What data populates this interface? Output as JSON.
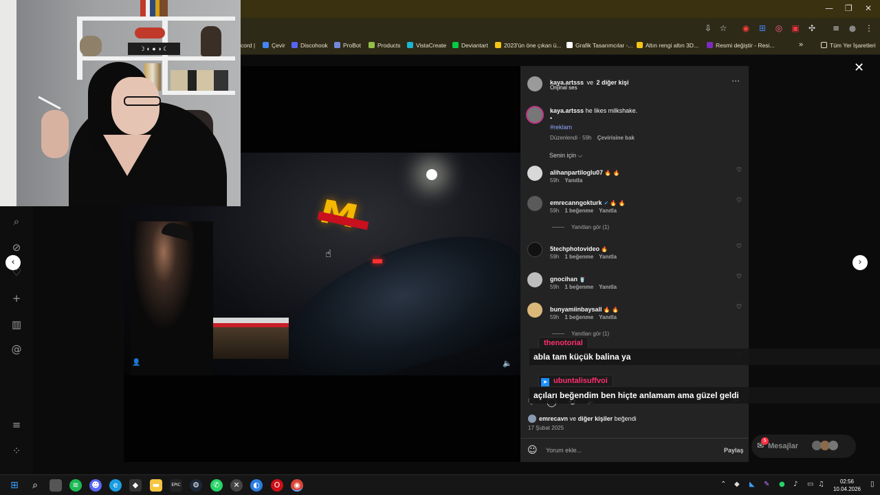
{
  "browser": {
    "bookmarks": [
      {
        "label": "cord |",
        "color": "#5865f2"
      },
      {
        "label": "Çevir",
        "color": "#4285f4"
      },
      {
        "label": "Discohook",
        "color": "#5865f2"
      },
      {
        "label": "ProBot",
        "color": "#7289da"
      },
      {
        "label": "Products",
        "color": "#95bf47"
      },
      {
        "label": "VistaCreate",
        "color": "#1bb6d2"
      },
      {
        "label": "Deviantart",
        "color": "#05cc47"
      },
      {
        "label": "2023'ün öne çıkan ü...",
        "color": "#f5c518"
      },
      {
        "label": "Grafik Tasarımcılar -...",
        "color": "#ffffff"
      },
      {
        "label": "Altın rengi altın 3D...",
        "color": "#f5c518"
      },
      {
        "label": "Resmi değiştir - Resi...",
        "color": "#7b2cbf"
      }
    ],
    "more_bookmarks": "»",
    "all_bookmarks": "Tüm Yer İşaretleri"
  },
  "post": {
    "header_user": "kaya.artsss",
    "header_connector": "ve",
    "header_others": "2 diğer kişi",
    "audio": "Orijinal ses",
    "more": "···",
    "caption_user": "kaya.artsss",
    "caption_text": "he likes milkshake.",
    "caption_dot": "•",
    "hashtag": "#reklam",
    "edited": "Düzenlendi · 59h",
    "translate": "Çevirisine bak",
    "sort": "Senin için ⌵",
    "likes_user": "emrecavn",
    "likes_connector": "ve",
    "likes_others": "diğer kişiler",
    "likes_suffix": "beğendi",
    "date": "17 Şubat 2025",
    "comment_placeholder": "Yorum ekle...",
    "share": "Paylaş"
  },
  "comments": [
    {
      "user": "alihanpartiloglu07",
      "emoji": "🔥 🔥",
      "time": "59h",
      "likes": "",
      "reply": "Yanıtla",
      "avatar": "#d8d8d8"
    },
    {
      "user": "emrecanngokturk",
      "emoji": "🔥 🔥",
      "verified": "✔",
      "time": "59h",
      "likes": "1 beğenme",
      "reply": "Yanıtla",
      "avatar": "#5a5a5a"
    },
    {
      "user": "5techphotovideo",
      "emoji": "🔥",
      "time": "59h",
      "likes": "1 beğenme",
      "reply": "Yanıtla",
      "avatar": "#111111"
    },
    {
      "user": "gnocihan",
      "emoji": "🥤",
      "time": "59h",
      "likes": "1 beğenme",
      "reply": "Yanıtla",
      "avatar": "#bdbdbd"
    },
    {
      "user": "bunyamiinbaysall",
      "emoji": "🔥 🔥",
      "time": "59h",
      "likes": "1 beğenme",
      "reply": "Yanıtla",
      "avatar": "#d9b87a"
    }
  ],
  "view_replies_1": "Yanıtları gör (1)",
  "view_replies_2": "Yanıtları gör (1)",
  "chat": [
    {
      "name": "thenotorial",
      "message": "abla tam küçük balina ya"
    },
    {
      "name": "ubuntalisuffvoi",
      "message": "açıları beğendim ben hiçte anlamam ama güzel geldi"
    }
  ],
  "messages_widget": {
    "label": "Mesajlar",
    "badge": "5"
  },
  "taskbar": {
    "time": "02:56",
    "date": "10.04.2026"
  }
}
